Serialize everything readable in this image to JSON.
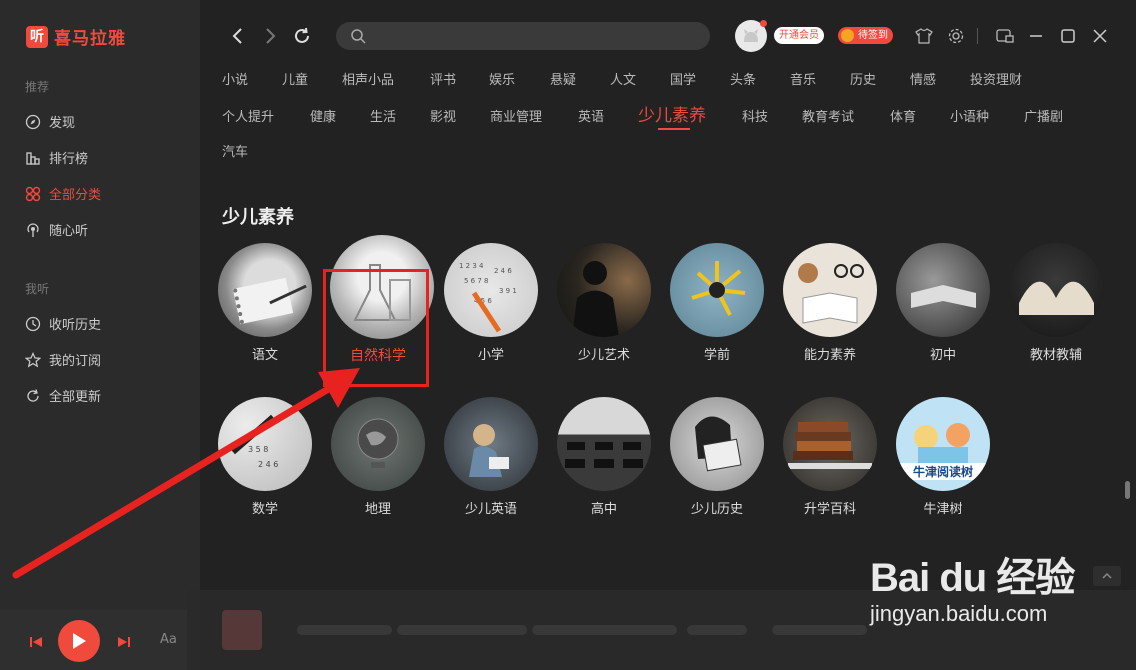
{
  "app": {
    "logo_char": "听",
    "logo_text": "喜马拉雅"
  },
  "sidebar": {
    "section_recommend": "推荐",
    "recommend_items": [
      {
        "label": "发现",
        "icon": "compass-icon"
      },
      {
        "label": "排行榜",
        "icon": "chart-icon"
      },
      {
        "label": "全部分类",
        "icon": "grid-icon",
        "active": true
      },
      {
        "label": "随心听",
        "icon": "radio-icon"
      }
    ],
    "section_mine": "我听",
    "mine_items": [
      {
        "label": "收听历史",
        "icon": "clock-icon"
      },
      {
        "label": "我的订阅",
        "icon": "star-icon"
      },
      {
        "label": "全部更新",
        "icon": "refresh-icon"
      }
    ]
  },
  "player": {
    "font_toggle": "Aa"
  },
  "topbar": {
    "vip_label": "开通会员",
    "sign_label": "待签到",
    "search_placeholder": ""
  },
  "categories": [
    "小说",
    "儿童",
    "相声小品",
    "评书",
    "娱乐",
    "悬疑",
    "人文",
    "国学",
    "头条",
    "音乐",
    "历史",
    "情感",
    "投资理财",
    "个人提升",
    "健康",
    "生活",
    "影视",
    "商业管理",
    "英语",
    "少儿素养",
    "科技",
    "教育考试",
    "体育",
    "小语种",
    "广播剧",
    "汽车"
  ],
  "active_category": "少儿素养",
  "section": {
    "title": "少儿素养",
    "items": [
      "语文",
      "自然科学",
      "小学",
      "少儿艺术",
      "学前",
      "能力素养",
      "初中",
      "教材教辅",
      "数学",
      "地理",
      "少儿英语",
      "高中",
      "少儿历史",
      "升学百科",
      "牛津树"
    ],
    "highlighted_item": "自然科学"
  },
  "oxford_cover_text": "牛津阅读树",
  "watermark": {
    "brand": "Bai du 经验",
    "url": "jingyan.baidu.com"
  },
  "colors": {
    "accent": "#ef4a3c",
    "highlight_box": "#e8231f",
    "background": "#222222",
    "sidebar": "#2b2b2b"
  }
}
